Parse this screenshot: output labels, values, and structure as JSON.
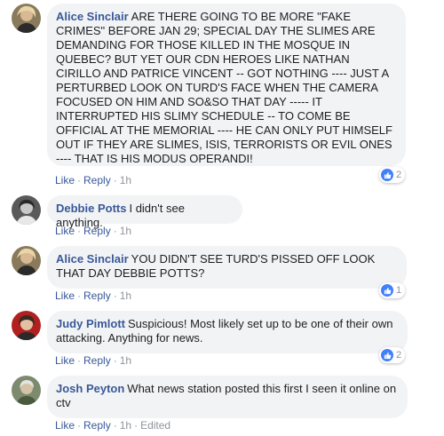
{
  "comments": [
    {
      "author": "Alice Sinclair",
      "text": "ARE THERE GOING TO BE MORE \"FAKE CRIMES\" BEFORE JAN 29; SPECIAL DAY THE SLIMES ARE DEMANDING FOR THOSE KILLED IN THE MOSQUE IN QUEBEC? BUT YET OUR CDN HEROES LIKE NATHAN CIRILLO AND PATRICE VINCENT -- GOT NOTHING ---- JUST A PERTURBED LOOK ON TURD'S FACE WHEN THE CAMERA FOCUSED ON HIM AND SO&SO THAT DAY ----- IT INTERRUPTED HIS SLIMY SCHEDULE -- TO COME BE OFFICIAL AT THE MEMORIAL ---- HE CAN ONLY PUT HIMSELF OUT IF THEY ARE SLIMES, ISIS, TERRORISTS OR EVIL ONES ---- THAT IS HIS MODUS OPERANDI!",
      "like": "Like",
      "reply": "Reply",
      "time": "1h",
      "reaction_count": "2",
      "reaction_icon": "thumbs-up-icon"
    },
    {
      "author": "Debbie Potts",
      "text": "I didn't see anything.",
      "like": "Like",
      "reply": "Reply",
      "time": "1h"
    },
    {
      "author": "Alice Sinclair",
      "text": "YOU DIDN'T SEE TURD'S PISSED OFF LOOK THAT DAY DEBBIE POTTS?",
      "like": "Like",
      "reply": "Reply",
      "time": "1h",
      "reaction_count": "1",
      "reaction_icon": "thumbs-up-icon"
    },
    {
      "author": "Judy Pimlott",
      "text": "Suspicious! Most likely set up to be one of their own attacking. Anything for news.",
      "like": "Like",
      "reply": "Reply",
      "time": "1h",
      "reaction_count": "2",
      "reaction_icon": "thumbs-up-icon"
    },
    {
      "author": "Josh Peyton",
      "text": "What news station posted this first I seen it online on ctv",
      "like": "Like",
      "reply": "Reply",
      "time": "1h",
      "edited": "Edited"
    }
  ],
  "colors": {
    "link": "#385898",
    "bubble": "#f2f3f5",
    "like_badge": "#4080ff"
  }
}
